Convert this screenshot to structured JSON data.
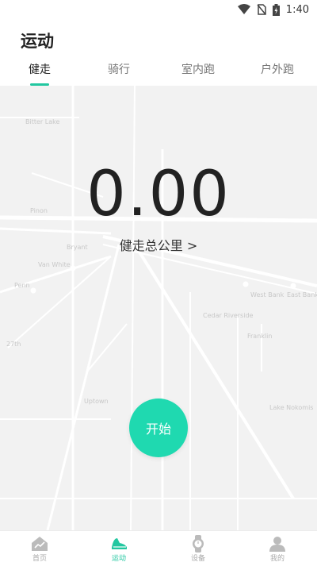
{
  "status_bar": {
    "time": "1:40"
  },
  "header": {
    "title": "运动"
  },
  "tabs": [
    {
      "label": "健走",
      "active": true
    },
    {
      "label": "骑行",
      "active": false
    },
    {
      "label": "室内跑",
      "active": false
    },
    {
      "label": "户外跑",
      "active": false
    }
  ],
  "map": {
    "labels": [
      "Bitter Lake",
      "Pinon",
      "Bryant",
      "Van White",
      "Penn",
      "Riverside",
      "West Bank",
      "East Bank",
      "Cedar Riverside",
      "Franklin",
      "Uptown",
      "Lake Nokomis",
      "27th"
    ]
  },
  "workout": {
    "distance": "0.00",
    "distance_label": "健走总公里 >",
    "start_label": "开始"
  },
  "bottom_nav": [
    {
      "label": "首页",
      "icon": "home-chart-icon",
      "active": false
    },
    {
      "label": "运动",
      "icon": "sneaker-icon",
      "active": true
    },
    {
      "label": "设备",
      "icon": "watch-icon",
      "active": false
    },
    {
      "label": "我的",
      "icon": "person-icon",
      "active": false
    }
  ],
  "colors": {
    "accent": "#22c7a0",
    "start_button": "#1fd9b0",
    "map_bg": "#f2f2f2"
  }
}
